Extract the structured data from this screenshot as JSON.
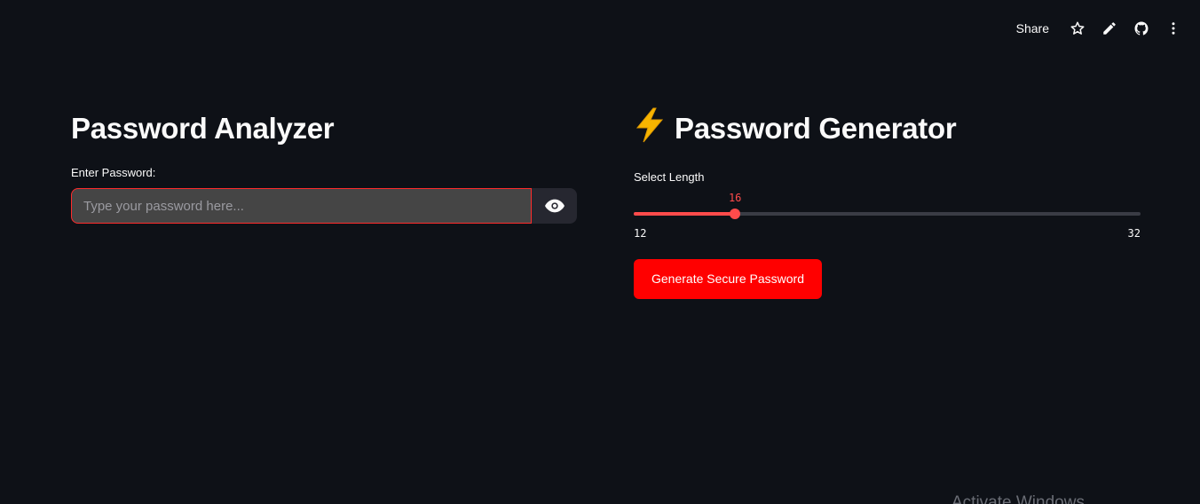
{
  "header": {
    "share_label": "Share",
    "icons": [
      "star-icon",
      "edit-pencil-icon",
      "github-icon",
      "more-vertical-icon"
    ]
  },
  "analyzer": {
    "title": "Password Analyzer",
    "input_label": "Enter Password:",
    "input_value": "",
    "input_placeholder": "Type your password here..."
  },
  "generator": {
    "title_emoji": "⚡",
    "title": "Password Generator",
    "slider_label": "Select Length",
    "slider": {
      "min": 12,
      "max": 32,
      "value": 16
    },
    "slider_value_text": "16",
    "slider_min_text": "12",
    "slider_max_text": "32",
    "button_label": "Generate Secure Password"
  },
  "colors": {
    "background": "#0e1117",
    "accent": "#ff4b4b",
    "button": "#ff0000",
    "input_bg": "#454545"
  },
  "watermark": "Activate Windows"
}
